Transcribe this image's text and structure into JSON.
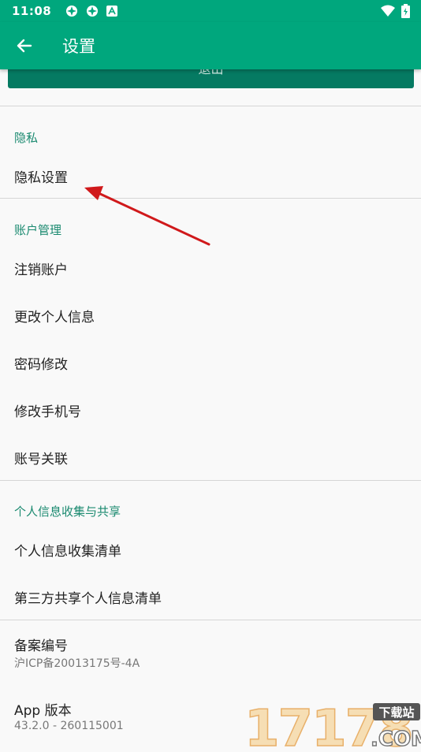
{
  "status": {
    "time": "11:08"
  },
  "appbar": {
    "title": "设置"
  },
  "top_button": {
    "label": "退出"
  },
  "sections": {
    "privacy": {
      "header": "隐私",
      "items": [
        "隐私设置"
      ]
    },
    "account": {
      "header": "账户管理",
      "items": [
        "注销账户",
        "更改个人信息",
        "密码修改",
        "修改手机号",
        "账号关联"
      ]
    },
    "info": {
      "header": "个人信息收集与共享",
      "items": [
        "个人信息收集清单",
        "第三方共享个人信息清单"
      ]
    }
  },
  "record": {
    "label": "备案编号",
    "value": "沪ICP备20013175号-4A"
  },
  "version": {
    "label": "App 版本",
    "value": "43.2.0 - 260115001"
  },
  "watermark": {
    "number": "17178",
    "tag": "下载站",
    "domain": ".COM"
  },
  "colors": {
    "primary": "#00a77d",
    "primary_dark": "#057a62",
    "section_text": "#1b8a70",
    "annotation_arrow": "#d0191b"
  }
}
